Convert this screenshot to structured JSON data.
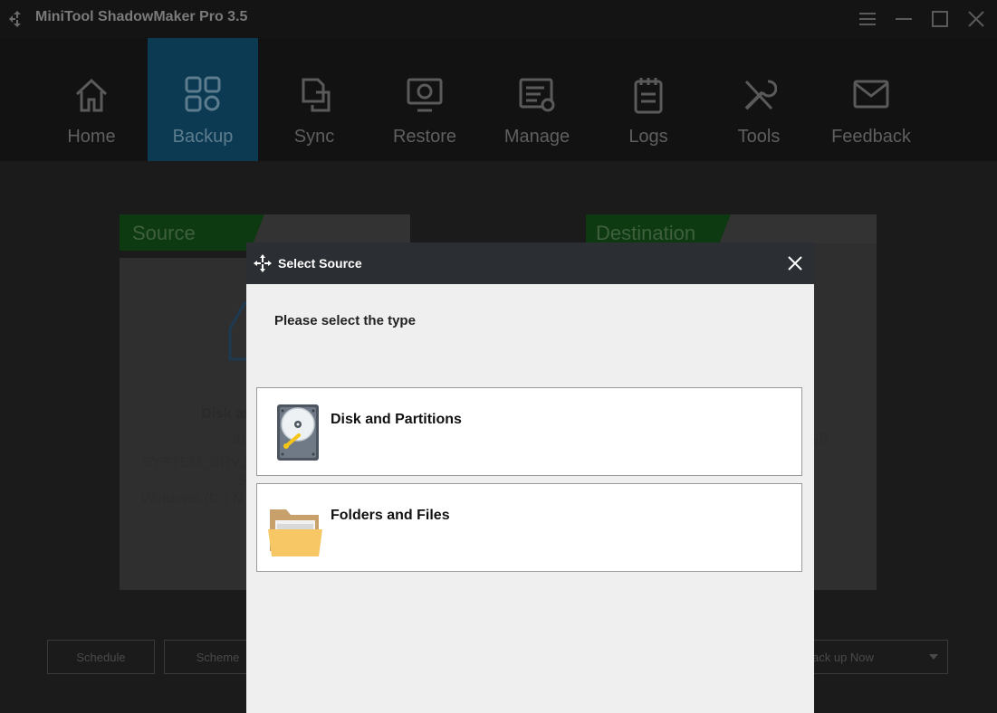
{
  "window": {
    "title": "MiniTool ShadowMaker Pro 3.5"
  },
  "nav": {
    "items": [
      {
        "label": "Home",
        "icon": "home-icon"
      },
      {
        "label": "Backup",
        "icon": "backup-icon"
      },
      {
        "label": "Sync",
        "icon": "sync-icon"
      },
      {
        "label": "Restore",
        "icon": "restore-icon"
      },
      {
        "label": "Manage",
        "icon": "manage-icon"
      },
      {
        "label": "Logs",
        "icon": "logs-icon"
      },
      {
        "label": "Tools",
        "icon": "tools-icon"
      },
      {
        "label": "Feedback",
        "icon": "feedback-icon"
      }
    ]
  },
  "source_panel": {
    "tab_label": "Source",
    "title_partial": "Disk ar",
    "size_partial": "30",
    "partitions_partial": "SYSTEM_DRV,(",
    "line4_partial": "S",
    "line5_partial": "Windows,(C:).N"
  },
  "destination_panel": {
    "tab_label": "Destination",
    "size_partial": "GB"
  },
  "bottom_bar": {
    "schedule_label": "Schedule",
    "scheme_label": "Scheme",
    "backup_now_label": "ack up Now"
  },
  "dialog": {
    "title": "Select Source",
    "prompt": "Please select the type",
    "options": [
      {
        "label": "Disk and Partitions",
        "icon": "hard-disk-icon"
      },
      {
        "label": "Folders and Files",
        "icon": "folder-icon"
      }
    ]
  }
}
